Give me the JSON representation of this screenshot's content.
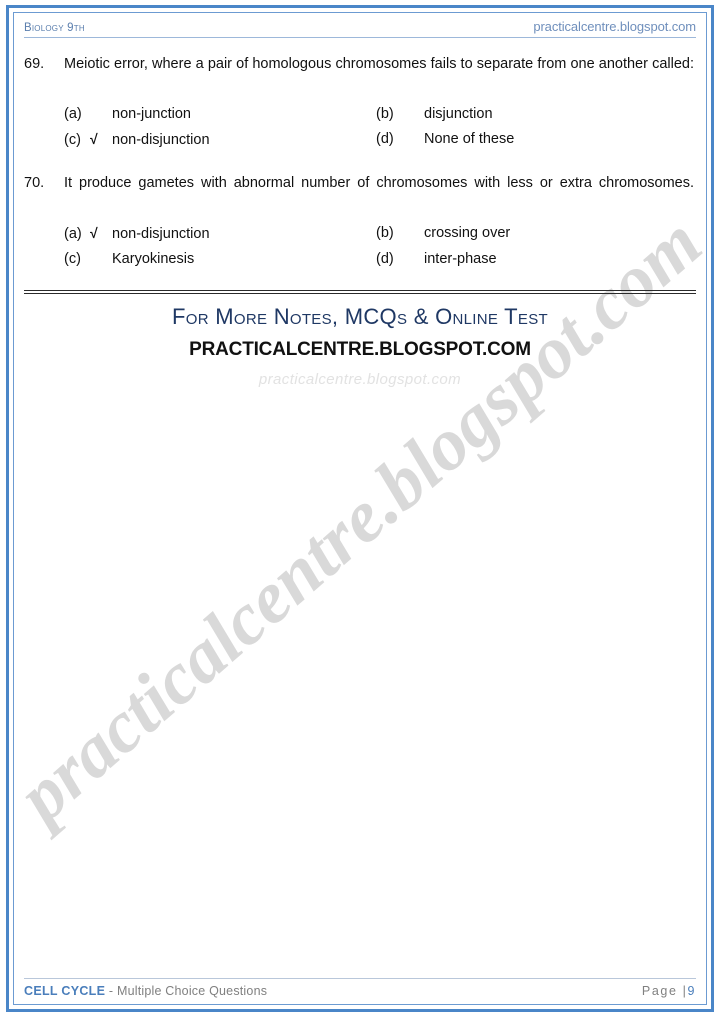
{
  "header": {
    "subject": "Biology 9th",
    "site": "practicalcentre.blogspot.com"
  },
  "questions": [
    {
      "number": "69.",
      "text": "Meiotic error, where a pair of homologous chromosomes fails to separate from one another called:",
      "options": [
        {
          "label": "(a)",
          "text": "non-junction",
          "check": ""
        },
        {
          "label": "(b)",
          "text": "disjunction",
          "check": ""
        },
        {
          "label": "(c)",
          "text": "non-disjunction",
          "check": "√"
        },
        {
          "label": "(d)",
          "text": "None of these",
          "check": ""
        }
      ]
    },
    {
      "number": "70.",
      "text": "It produce gametes with abnormal number of chromosomes with less or extra chromosomes.",
      "options": [
        {
          "label": "(a)",
          "text": "non-disjunction",
          "check": "√"
        },
        {
          "label": "(b)",
          "text": "crossing over",
          "check": ""
        },
        {
          "label": "(c)",
          "text": "Karyokinesis",
          "check": ""
        },
        {
          "label": "(d)",
          "text": "inter-phase",
          "check": ""
        }
      ]
    }
  ],
  "promo": {
    "line1": "For More Notes, MCQs & Online Test",
    "line2": "PRACTICALCENTRE.BLOGSPOT.COM",
    "line3": "practicalcentre.blogspot.com"
  },
  "watermark": {
    "text": "practicalcentre.blogspot.com"
  },
  "footer": {
    "chapter": "CELL CYCLE",
    "subtitle": " - Multiple Choice Questions",
    "page_label": "Page |",
    "page_number": "9"
  },
  "colors": {
    "border_outer": "#4A86C8",
    "border_inner": "#6C9BD2",
    "header_text": "#5B7FAE",
    "promo_blue": "#1F3864",
    "footer_blue": "#4A7EBB",
    "watermark_grey": "#D9D9D9"
  }
}
